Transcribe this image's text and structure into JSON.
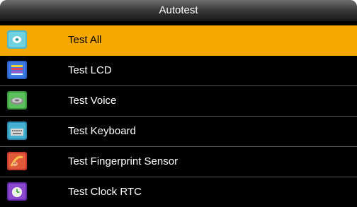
{
  "title": "Autotest",
  "menu": {
    "items": [
      {
        "label": "Test All",
        "icon": "test-all-icon",
        "selected": true
      },
      {
        "label": "Test LCD",
        "icon": "lcd-icon",
        "selected": false
      },
      {
        "label": "Test Voice",
        "icon": "voice-icon",
        "selected": false
      },
      {
        "label": "Test Keyboard",
        "icon": "keyboard-icon",
        "selected": false
      },
      {
        "label": "Test Fingerprint Sensor",
        "icon": "fingerprint-icon",
        "selected": false
      },
      {
        "label": "Test Clock RTC",
        "icon": "clock-icon",
        "selected": false
      }
    ]
  },
  "colors": {
    "selection": "#f7a800",
    "background": "#000000",
    "title_text": "#ffffff"
  }
}
